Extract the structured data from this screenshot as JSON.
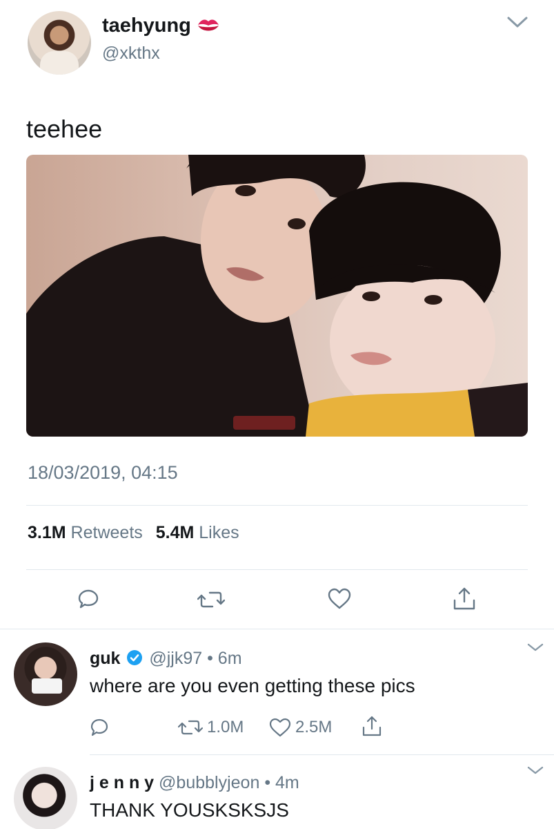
{
  "main_tweet": {
    "display_name": "taehyung",
    "handle": "@xkthx",
    "name_emoji_icon": "kiss-mark-icon",
    "text": "teehee",
    "timestamp": "18/03/2019, 04:15",
    "retweets_count": "3.1M",
    "retweets_label": "Retweets",
    "likes_count": "5.4M",
    "likes_label": "Likes"
  },
  "replies": [
    {
      "display_name": "guk",
      "verified": true,
      "handle": "@jjk97",
      "time": "• 6m",
      "text": "where are you even getting these pics",
      "retweets": "1.0M",
      "likes": "2.5M"
    },
    {
      "display_name": "j e n n y",
      "handle": "@bubblyjeon",
      "time": "• 4m",
      "text": "THANK YOUSKSKSJS"
    }
  ],
  "colors": {
    "text": "#14171a",
    "muted": "#657786",
    "verified": "#1da1f2",
    "divider": "#e1e8ed",
    "kiss": "#e0245e"
  }
}
